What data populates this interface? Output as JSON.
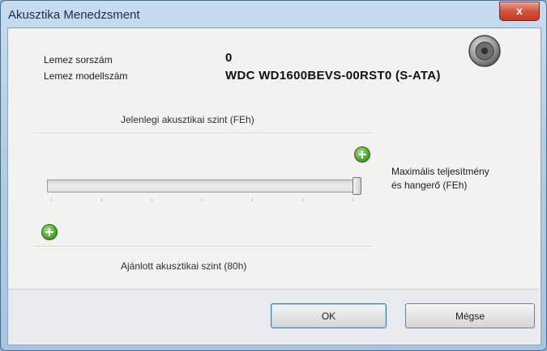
{
  "window": {
    "title": "Akusztika Menedzsment",
    "close_glyph": "x"
  },
  "disk": {
    "serial_label": "Lemez sorszám",
    "serial_value": "0",
    "model_label": "Lemez modellszám",
    "model_value": "WDC WD1600BEVS-00RST0 (S-ATA)"
  },
  "acoustic": {
    "current_label": "Jelenlegi akusztikai szint (FEh)",
    "max_label_line1": "Maximális teljesítmény",
    "max_label_line2": "és hangerő (FEh)",
    "recommended_label": "Ajánlott akusztikai szint (80h)",
    "slider_level_fraction": 1.0
  },
  "buttons": {
    "ok": "OK",
    "cancel": "Mégse"
  },
  "icons": [
    "speaker-icon",
    "plus-icon",
    "close-icon"
  ],
  "colors": {
    "accent": "#3c7fb1",
    "close": "#c23a22",
    "plus": "#4aa52e"
  }
}
